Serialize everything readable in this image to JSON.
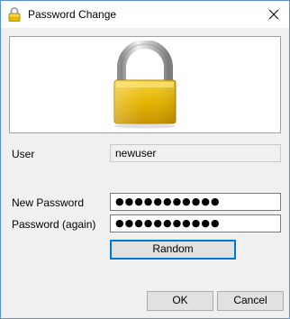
{
  "window": {
    "title": "Password Change",
    "title_icon": "padlock-icon",
    "close_icon": "close-icon"
  },
  "banner": {
    "image_icon": "padlock-image"
  },
  "form": {
    "user_label": "User",
    "user_value": "newuser",
    "new_password_label": "New Password",
    "new_password_value": "●●●●●●●●●●●",
    "password_again_label": "Password (again)",
    "password_again_value": "●●●●●●●●●●●"
  },
  "buttons": {
    "random": "Random",
    "ok": "OK",
    "cancel": "Cancel"
  },
  "colors": {
    "accent": "#0078d7",
    "lock_gold": "#e6b200",
    "lock_shackle": "#c0c0c0"
  }
}
